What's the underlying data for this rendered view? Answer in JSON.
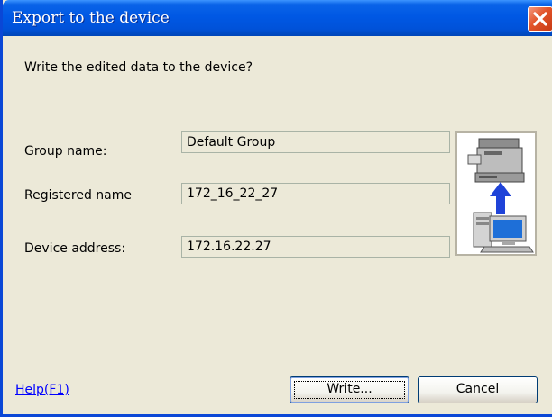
{
  "window": {
    "title": "Export to the device",
    "prompt": "Write the edited data to the device?"
  },
  "fields": [
    {
      "label": "Group name:",
      "value": "Default Group"
    },
    {
      "label": "Registered name",
      "value": "172_16_22_27"
    },
    {
      "label": "Device address:",
      "value": "172.16.22.27"
    }
  ],
  "footer": {
    "help_link": "Help(F1)",
    "write_button": "Write...",
    "cancel_button": "Cancel"
  },
  "icons": {
    "close": "close-icon",
    "illustration": "printer-to-computer-icon"
  },
  "colors": {
    "titlebar": "#0058E4",
    "close": "#E2542A",
    "background": "#ECE9D8",
    "link": "#0000FF"
  }
}
